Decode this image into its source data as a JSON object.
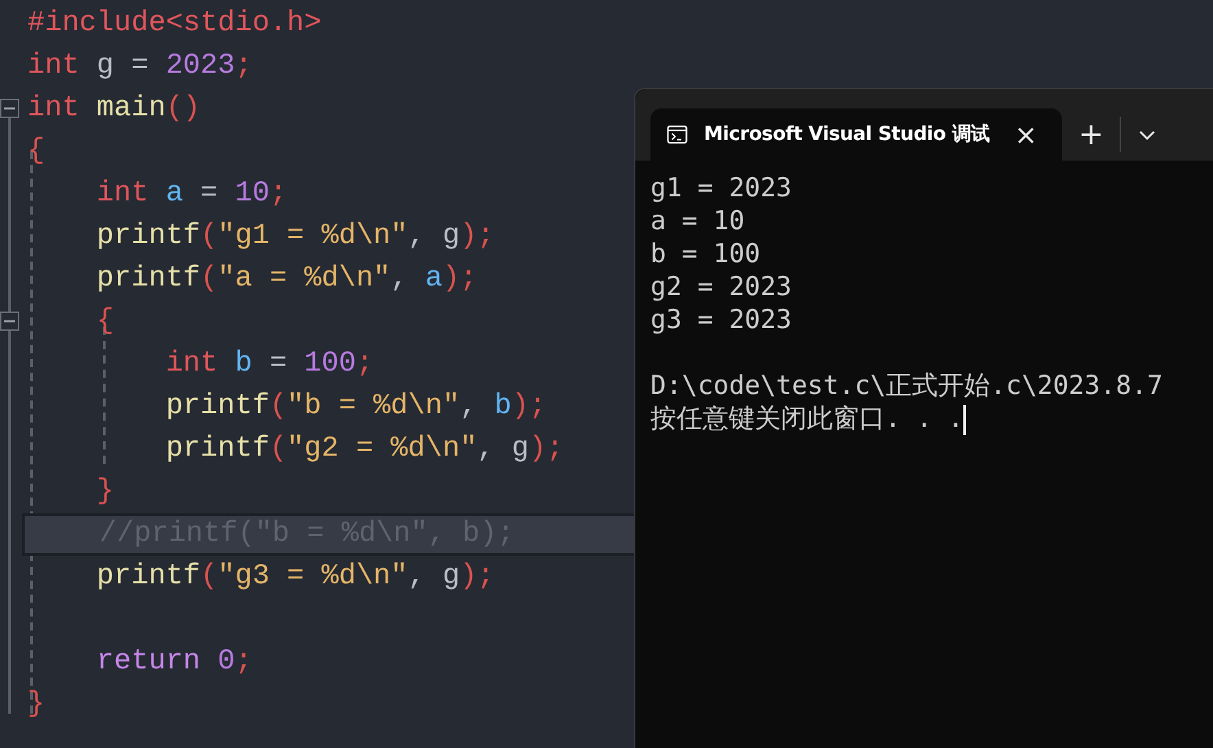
{
  "editor": {
    "lines": [
      {
        "selected": false,
        "tokens": [
          {
            "kind": "keyword",
            "text": "#include<stdio.h>"
          }
        ]
      },
      {
        "selected": false,
        "tokens": [
          {
            "kind": "keyword",
            "text": "int"
          },
          {
            "kind": "plain",
            "text": " g = "
          },
          {
            "kind": "number",
            "text": "2023"
          },
          {
            "kind": "punct",
            "text": ";"
          }
        ]
      },
      {
        "selected": false,
        "expanded": true,
        "tokens": [
          {
            "kind": "keyword",
            "text": "int"
          },
          {
            "kind": "func",
            "text": " main"
          },
          {
            "kind": "punct",
            "text": "()"
          }
        ]
      },
      {
        "selected": false,
        "tokens": [
          {
            "kind": "punct",
            "text": "{"
          }
        ]
      },
      {
        "selected": false,
        "tokens": [
          {
            "kind": "keyword",
            "text": "    int"
          },
          {
            "kind": "var",
            "text": " a"
          },
          {
            "kind": "plain",
            "text": " = "
          },
          {
            "kind": "number",
            "text": "10"
          },
          {
            "kind": "punct",
            "text": ";"
          }
        ]
      },
      {
        "selected": false,
        "tokens": [
          {
            "kind": "func",
            "text": "    printf"
          },
          {
            "kind": "punct",
            "text": "("
          },
          {
            "kind": "string",
            "text": "\"g1 = %d\\n\""
          },
          {
            "kind": "plain",
            "text": ", g"
          },
          {
            "kind": "punct",
            "text": ");"
          }
        ]
      },
      {
        "selected": false,
        "tokens": [
          {
            "kind": "func",
            "text": "    printf"
          },
          {
            "kind": "punct",
            "text": "("
          },
          {
            "kind": "string",
            "text": "\"a = %d\\n\""
          },
          {
            "kind": "plain",
            "text": ", "
          },
          {
            "kind": "var",
            "text": "a"
          },
          {
            "kind": "punct",
            "text": ");"
          }
        ]
      },
      {
        "selected": false,
        "expanded": true,
        "tokens": [
          {
            "kind": "punct",
            "text": "    {"
          }
        ]
      },
      {
        "selected": false,
        "tokens": [
          {
            "kind": "keyword",
            "text": "        int"
          },
          {
            "kind": "var",
            "text": " b"
          },
          {
            "kind": "plain",
            "text": " = "
          },
          {
            "kind": "number",
            "text": "100"
          },
          {
            "kind": "punct",
            "text": ";"
          }
        ]
      },
      {
        "selected": false,
        "tokens": [
          {
            "kind": "func",
            "text": "        printf"
          },
          {
            "kind": "punct",
            "text": "("
          },
          {
            "kind": "string",
            "text": "\"b = %d\\n\""
          },
          {
            "kind": "plain",
            "text": ", "
          },
          {
            "kind": "var",
            "text": "b"
          },
          {
            "kind": "punct",
            "text": ");"
          }
        ]
      },
      {
        "selected": false,
        "tokens": [
          {
            "kind": "func",
            "text": "        printf"
          },
          {
            "kind": "punct",
            "text": "("
          },
          {
            "kind": "string",
            "text": "\"g2 = %d\\n\""
          },
          {
            "kind": "plain",
            "text": ", g"
          },
          {
            "kind": "punct",
            "text": ");"
          }
        ]
      },
      {
        "selected": false,
        "tokens": [
          {
            "kind": "punct",
            "text": "    }"
          }
        ]
      },
      {
        "selected": true,
        "tokens": [
          {
            "kind": "comment",
            "text": "    //printf(\"b = %d\\n\", b);"
          }
        ]
      },
      {
        "selected": false,
        "tokens": [
          {
            "kind": "func",
            "text": "    printf"
          },
          {
            "kind": "punct",
            "text": "("
          },
          {
            "kind": "string",
            "text": "\"g3 = %d\\n\""
          },
          {
            "kind": "plain",
            "text": ", g"
          },
          {
            "kind": "punct",
            "text": ");"
          }
        ]
      },
      {
        "selected": false
      },
      {
        "selected": false,
        "tokens": [
          {
            "kind": "control",
            "text": "    return"
          },
          {
            "kind": "number",
            "text": " 0"
          },
          {
            "kind": "punct",
            "text": ";"
          }
        ]
      },
      {
        "selected": false,
        "tokens": [
          {
            "kind": "punct",
            "text": "}"
          }
        ]
      }
    ]
  },
  "terminal": {
    "tab": {
      "title": "Microsoft Visual Studio 调试",
      "close": "×",
      "selected": true
    },
    "new_tab": "+",
    "output": [
      "g1 = 2023",
      "a = 10",
      "b = 100",
      "g2 = 2023",
      "g3 = 2023"
    ],
    "footer": [
      "D:\\code\\test.c\\正式开始.c\\2023.8.7",
      "按任意键关闭此窗口. . ."
    ],
    "cursor": true
  }
}
